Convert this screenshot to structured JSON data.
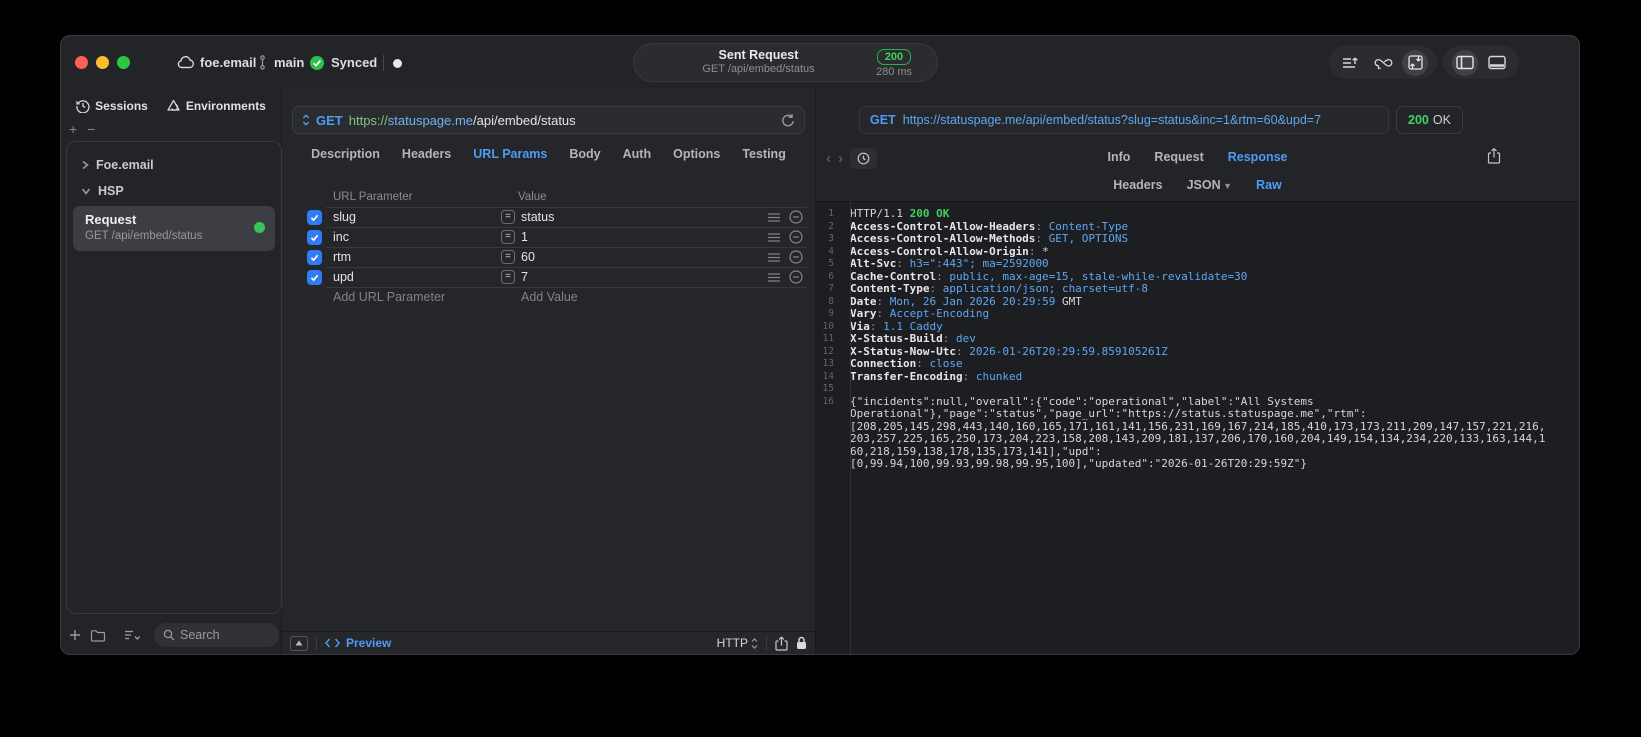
{
  "titlebar": {
    "project": "foe.email",
    "branch": "main",
    "sync_label": "Synced",
    "request_title": "Sent Request",
    "request_subtitle": "GET /api/embed/status",
    "status_code": "200",
    "duration": "280 ms"
  },
  "sidebar": {
    "tab_sessions": "Sessions",
    "tab_environments": "Environments",
    "group_collapsed": "Foe.email",
    "group_expanded": "HSP",
    "request_title": "Request",
    "request_subtitle": "GET /api/embed/status",
    "search_placeholder": "Search"
  },
  "request": {
    "method": "GET",
    "url_scheme": "https://",
    "url_host": "statuspage.me",
    "url_path": "/api/embed/status",
    "tabs": [
      "Description",
      "Headers",
      "URL Params",
      "Body",
      "Auth",
      "Options",
      "Testing"
    ],
    "active_tab": "URL Params",
    "table": {
      "col_param": "URL Parameter",
      "col_value": "Value",
      "rows": [
        {
          "name": "slug",
          "value": "status",
          "enabled": true
        },
        {
          "name": "inc",
          "value": "1",
          "enabled": true
        },
        {
          "name": "rtm",
          "value": "60",
          "enabled": true
        },
        {
          "name": "upd",
          "value": "7",
          "enabled": true
        }
      ],
      "add_param": "Add URL Parameter",
      "add_value": "Add Value"
    },
    "footer": {
      "preview": "Preview",
      "protocol": "HTTP"
    }
  },
  "response": {
    "method": "GET",
    "url": "https://statuspage.me/api/embed/status?slug=status&inc=1&rtm=60&upd=7",
    "status_code": "200",
    "status_text": "OK",
    "tabs": [
      "Info",
      "Request",
      "Response"
    ],
    "active_tab": "Response",
    "subtabs": [
      "Headers",
      "JSON",
      "Raw"
    ],
    "active_subtab": "Raw",
    "header_lines": [
      {
        "n": "1",
        "seg": [
          {
            "t": "HTTP/1.1 ",
            "c": "p"
          },
          {
            "t": "200 OK",
            "c": "g"
          }
        ]
      },
      {
        "n": "2",
        "seg": [
          {
            "t": "Access-Control-Allow-Headers",
            "c": "h"
          },
          {
            "t": ": ",
            "c": "d"
          },
          {
            "t": "Content-Type",
            "c": "v"
          }
        ]
      },
      {
        "n": "3",
        "seg": [
          {
            "t": "Access-Control-Allow-Methods",
            "c": "h"
          },
          {
            "t": ": ",
            "c": "d"
          },
          {
            "t": "GET, OPTIONS",
            "c": "v"
          }
        ]
      },
      {
        "n": "4",
        "seg": [
          {
            "t": "Access-Control-Allow-Origin",
            "c": "h"
          },
          {
            "t": ": ",
            "c": "d"
          },
          {
            "t": "*",
            "c": "p"
          }
        ]
      },
      {
        "n": "5",
        "seg": [
          {
            "t": "Alt-Svc",
            "c": "h"
          },
          {
            "t": ": ",
            "c": "d"
          },
          {
            "t": "h3=\":443\"; ma=2592000",
            "c": "v"
          }
        ]
      },
      {
        "n": "6",
        "seg": [
          {
            "t": "Cache-Control",
            "c": "h"
          },
          {
            "t": ": ",
            "c": "d"
          },
          {
            "t": "public, max-age=15, stale-while-revalidate=30",
            "c": "v"
          }
        ]
      },
      {
        "n": "7",
        "seg": [
          {
            "t": "Content-Type",
            "c": "h"
          },
          {
            "t": ": ",
            "c": "d"
          },
          {
            "t": "application/json; charset=utf-8",
            "c": "v"
          }
        ]
      },
      {
        "n": "8",
        "seg": [
          {
            "t": "Date",
            "c": "h"
          },
          {
            "t": ": ",
            "c": "d"
          },
          {
            "t": "Mon, 26 Jan 2026 20:29:59",
            "c": "v"
          },
          {
            "t": " GMT",
            "c": "p"
          }
        ]
      },
      {
        "n": "9",
        "seg": [
          {
            "t": "Vary",
            "c": "h"
          },
          {
            "t": ": ",
            "c": "d"
          },
          {
            "t": "Accept-Encoding",
            "c": "v"
          }
        ]
      },
      {
        "n": "10",
        "seg": [
          {
            "t": "Via",
            "c": "h"
          },
          {
            "t": ": ",
            "c": "d"
          },
          {
            "t": "1.1 Caddy",
            "c": "v"
          }
        ]
      },
      {
        "n": "11",
        "seg": [
          {
            "t": "X-Status-Build",
            "c": "h"
          },
          {
            "t": ": ",
            "c": "d"
          },
          {
            "t": "dev",
            "c": "v"
          }
        ]
      },
      {
        "n": "12",
        "seg": [
          {
            "t": "X-Status-Now-Utc",
            "c": "h"
          },
          {
            "t": ": ",
            "c": "d"
          },
          {
            "t": "2026-01-26T20:29:59.859105261Z",
            "c": "v"
          }
        ]
      },
      {
        "n": "13",
        "seg": [
          {
            "t": "Connection",
            "c": "h"
          },
          {
            "t": ": ",
            "c": "d"
          },
          {
            "t": "close",
            "c": "v"
          }
        ]
      },
      {
        "n": "14",
        "seg": [
          {
            "t": "Transfer-Encoding",
            "c": "h"
          },
          {
            "t": ": ",
            "c": "d"
          },
          {
            "t": "chunked",
            "c": "v"
          }
        ]
      },
      {
        "n": "15",
        "seg": []
      }
    ],
    "body_line_number": "16",
    "body_lines": [
      "{\"incidents\":null,\"overall\":{\"code\":\"operational\",\"label\":\"All Systems",
      "Operational\"},\"page\":\"status\",\"page_url\":\"https://status.statuspage.me\",\"rtm\":",
      "[208,205,145,298,443,140,160,165,171,161,141,156,231,169,167,214,185,410,173,173,211,209,147,157,221,216,",
      "203,257,225,165,250,173,204,223,158,208,143,209,181,137,206,170,160,204,149,154,134,234,220,133,163,144,1",
      "60,218,159,138,178,135,173,141],\"upd\":",
      "[0,99.94,100,99.93,99.98,99.95,100],\"updated\":\"2026-01-26T20:29:59Z\"}"
    ]
  }
}
